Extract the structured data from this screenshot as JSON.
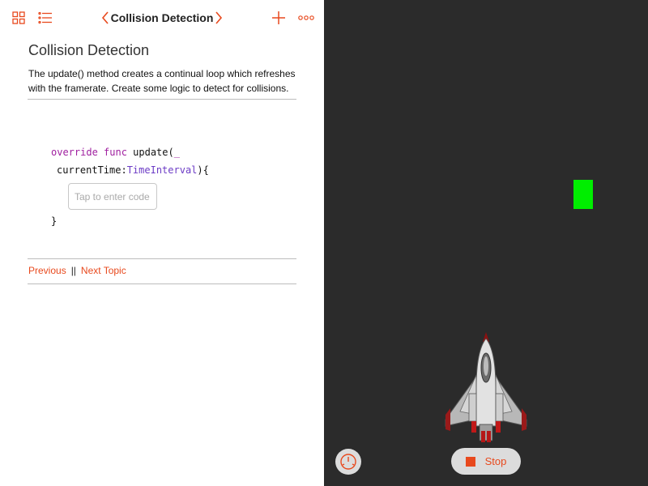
{
  "navbar": {
    "title": "Collision Detection"
  },
  "content": {
    "heading": "Collision Detection",
    "description": "The update() method creates a continual loop which refreshes with the framerate.  Create some logic to detect for collisions.",
    "code": {
      "line1_kw": "override func",
      "line1_rest": " update(",
      "line1_underscore": "_",
      "line2_param": "currentTime:",
      "line2_type": "TimeInterval",
      "line2_rest": "){",
      "input_placeholder": "Tap to enter code",
      "line4": "}"
    },
    "footer": {
      "previous": "Previous",
      "separator": "||",
      "next": "Next Topic"
    }
  },
  "live_view": {
    "stop_label": "Stop"
  },
  "colors": {
    "accent": "#e8491d",
    "keyword": "#a020a0",
    "type": "#6c3cc6",
    "live_bg": "#2b2b2b",
    "target": "#00ee00"
  }
}
